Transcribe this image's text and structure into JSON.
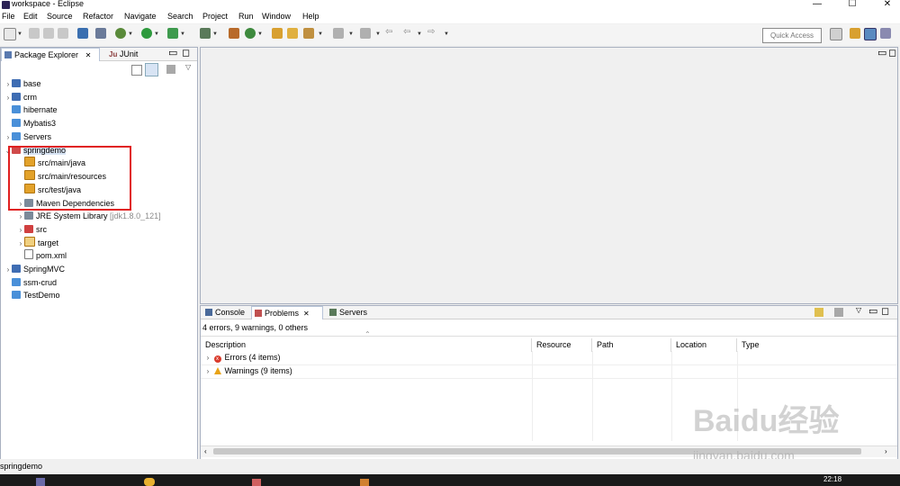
{
  "window": {
    "title": "workspace - Eclipse",
    "controls": [
      "—",
      "☐",
      "✕"
    ]
  },
  "menu": [
    "File",
    "Edit",
    "Source",
    "Refactor",
    "Navigate",
    "Search",
    "Project",
    "Run",
    "Window",
    "Help"
  ],
  "toolbar": {
    "quick_access": "Quick Access"
  },
  "package_explorer": {
    "tabs": [
      {
        "label": "Package Explorer",
        "close": "✕"
      },
      {
        "label": "JUnit"
      }
    ],
    "tree": [
      {
        "label": "base",
        "expanded": false,
        "icon": "project-icon"
      },
      {
        "label": "crm",
        "expanded": false,
        "icon": "project-icon"
      },
      {
        "label": "hibernate",
        "icon": "folder-icon"
      },
      {
        "label": "Mybatis3",
        "icon": "folder-icon"
      },
      {
        "label": "Servers",
        "expanded": false,
        "icon": "folder-icon"
      },
      {
        "label": "springdemo",
        "expanded": true,
        "icon": "project-icon"
      },
      {
        "label": "src/main/java",
        "icon": "package-icon"
      },
      {
        "label": "src/main/resources",
        "icon": "package-icon"
      },
      {
        "label": "src/test/java",
        "icon": "package-icon"
      },
      {
        "label": "Maven Dependencies",
        "icon": "library-icon"
      },
      {
        "label": "JRE System Library",
        "extra": "[jdk1.8.0_121]",
        "icon": "library-icon"
      },
      {
        "label": "src",
        "icon": "src-folder-icon"
      },
      {
        "label": "target",
        "icon": "folder-icon"
      },
      {
        "label": "pom.xml",
        "icon": "xml-file-icon"
      },
      {
        "label": "SpringMVC",
        "icon": "project-icon"
      },
      {
        "label": "ssm-crud",
        "icon": "folder-icon"
      },
      {
        "label": "TestDemo",
        "icon": "folder-icon"
      }
    ]
  },
  "problems_view": {
    "tabs": [
      {
        "label": "Console"
      },
      {
        "label": "Problems",
        "close": "✕"
      },
      {
        "label": "Servers"
      }
    ],
    "summary": "4 errors, 9 warnings, 0 others",
    "columns": [
      "Description",
      "Resource",
      "Path",
      "Location",
      "Type"
    ],
    "rows": [
      {
        "label": "Errors (4 items)",
        "icon": "error-icon"
      },
      {
        "label": "Warnings (9 items)",
        "icon": "warning-icon"
      }
    ]
  },
  "status_bar": {
    "text": "springdemo",
    "clock": "22:18"
  },
  "watermark": {
    "brand": "Baidu经验",
    "url": "jingyan.baidu.com"
  },
  "colors": {
    "highlight_box": "#e02020",
    "panel_border": "#a8b0c0",
    "error": "#d93a2b",
    "warning": "#e8a317"
  }
}
